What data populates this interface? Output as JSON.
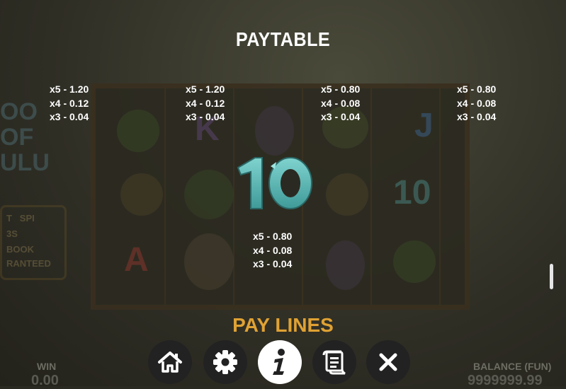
{
  "title": "PAYTABLE",
  "paytable": [
    {
      "lines": [
        "x5 - 1.20",
        "x4 - 0.12",
        "x3 - 0.04"
      ]
    },
    {
      "lines": [
        "x5 - 1.20",
        "x4 - 0.12",
        "x3 - 0.04"
      ]
    },
    {
      "lines": [
        "x5 - 0.80",
        "x4 - 0.08",
        "x3 - 0.04"
      ]
    },
    {
      "lines": [
        "x5 - 0.80",
        "x4 - 0.08",
        "x3 - 0.04"
      ]
    },
    {
      "lines": [
        "x5 - 0.80",
        "x4 - 0.08",
        "x3 - 0.04"
      ]
    }
  ],
  "featured_symbol": {
    "label": "10",
    "icon": "ten-symbol-icon",
    "color": "#5fb7b5"
  },
  "section_heading": "PAY LINES",
  "footer": {
    "win_label": "WIN",
    "win_value": "0.00",
    "balance_label": "BALANCE (FUN)",
    "balance_value": "9999999.99"
  },
  "buttons": [
    {
      "name": "home",
      "icon": "home-icon",
      "active": false
    },
    {
      "name": "settings",
      "icon": "gear-icon",
      "active": false
    },
    {
      "name": "info",
      "icon": "info-icon",
      "active": true
    },
    {
      "name": "history",
      "icon": "scroll-icon",
      "active": false
    },
    {
      "name": "close",
      "icon": "close-icon",
      "active": false
    }
  ],
  "colors": {
    "accent": "#e0a233",
    "text": "#ffffff",
    "symbol": "#5fb7b5"
  }
}
